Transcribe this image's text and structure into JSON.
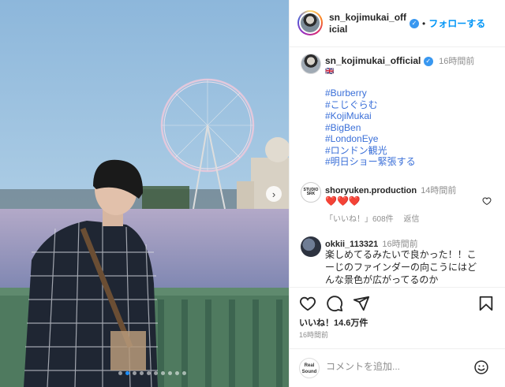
{
  "header": {
    "username": "sn_kojimukai_official",
    "separator": "•",
    "follow_label": "フォローする",
    "verified_icon": "verified-badge-icon"
  },
  "caption": {
    "username": "sn_kojimukai_official",
    "time": "16時間前",
    "flag": "🇬🇧",
    "tags": [
      "#Burberry",
      "#こじぐらむ",
      "#KojiMukai",
      "#BigBen",
      "#LondonEye",
      "#ロンドン観光",
      "#明日ショー緊張する"
    ]
  },
  "comments": [
    {
      "username": "shoryuken.production",
      "time": "14時間前",
      "text": "❤️❤️❤️",
      "likes": "「いいね！」608件",
      "reply_label": "返信",
      "avatar_text": "STUDIO SRK"
    },
    {
      "username": "okkii_113321",
      "time": "16時間前",
      "text": "楽しめてるみたいで良かった！！こーじのファインダーの向こうにはどんな景色が広がってるのか"
    }
  ],
  "actions": {
    "likes_label": "いいね！14.6万件",
    "post_time": "16時間前"
  },
  "comment_box": {
    "placeholder": "コメントを追加...",
    "avatar_text": "Real Sound"
  },
  "carousel": {
    "next_icon": "chevron-right-icon",
    "current_index": 1,
    "total": 10
  },
  "colors": {
    "link": "#0095f6",
    "hashtag": "#3a6fd8",
    "muted": "#8e8e8e",
    "heart": "#e0245e"
  }
}
